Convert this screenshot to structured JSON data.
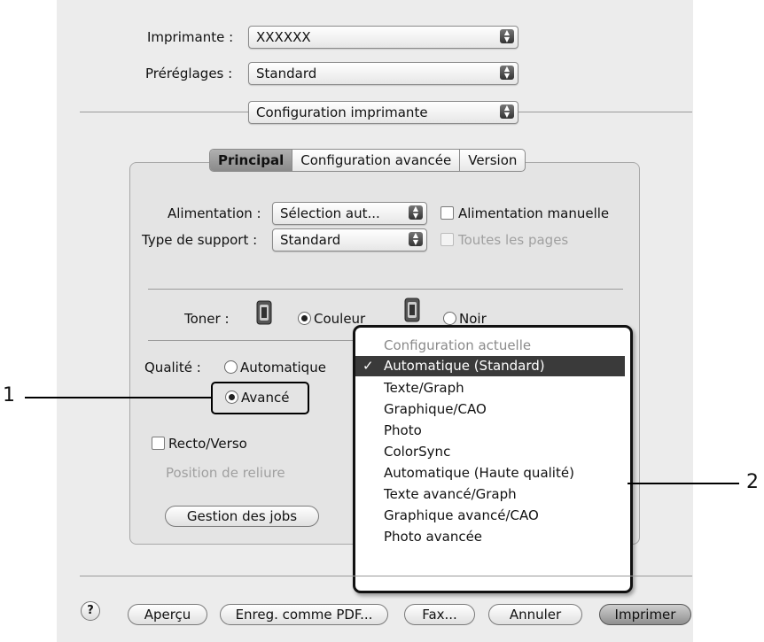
{
  "header": {
    "printer_label": "Imprimante :",
    "printer_value": "XXXXXX",
    "presets_label": "Préréglages :",
    "presets_value": "Standard",
    "section_value": "Configuration imprimante"
  },
  "tabs": [
    {
      "label": "Principal",
      "active": true
    },
    {
      "label": "Configuration avancée",
      "active": false
    },
    {
      "label": "Version",
      "active": false
    }
  ],
  "panel": {
    "feed_label": "Alimentation :",
    "feed_value": "Sélection aut...",
    "manual_feed_label": "Alimentation manuelle",
    "media_label": "Type de support :",
    "media_value": "Standard",
    "all_pages_label": "Toutes les pages",
    "toner_label": "Toner :",
    "toner_color_label": "Couleur",
    "toner_black_label": "Noir",
    "quality_label": "Qualité :",
    "quality_auto_label": "Automatique",
    "quality_advanced_label": "Avancé",
    "duplex_label": "Recto/Verso",
    "binding_label": "Position de reliure",
    "jobs_button": "Gestion des jobs"
  },
  "dropdown_menu": {
    "items": [
      {
        "label": "Configuration actuelle",
        "type": "header"
      },
      {
        "label": "Automatique (Standard)",
        "type": "selected"
      },
      {
        "label": "Texte/Graph",
        "type": "item"
      },
      {
        "label": "Graphique/CAO",
        "type": "item"
      },
      {
        "label": "Photo",
        "type": "item"
      },
      {
        "label": "ColorSync",
        "type": "item"
      },
      {
        "label": "Automatique (Haute qualité)",
        "type": "item"
      },
      {
        "label": "Texte avancé/Graph",
        "type": "item"
      },
      {
        "label": "Graphique avancé/CAO",
        "type": "item"
      },
      {
        "label": "Photo avancée",
        "type": "item"
      }
    ],
    "checkmark": "✓"
  },
  "footer": {
    "help": "?",
    "preview": "Aperçu",
    "save_pdf": "Enreg. comme PDF...",
    "fax": "Fax...",
    "cancel": "Annuler",
    "print": "Imprimer"
  },
  "callouts": {
    "one": "1",
    "two": "2"
  },
  "icons": {
    "popup_arrows": "updown-arrows-icon",
    "toner": "toner-cartridge-icon",
    "help": "help-icon"
  }
}
